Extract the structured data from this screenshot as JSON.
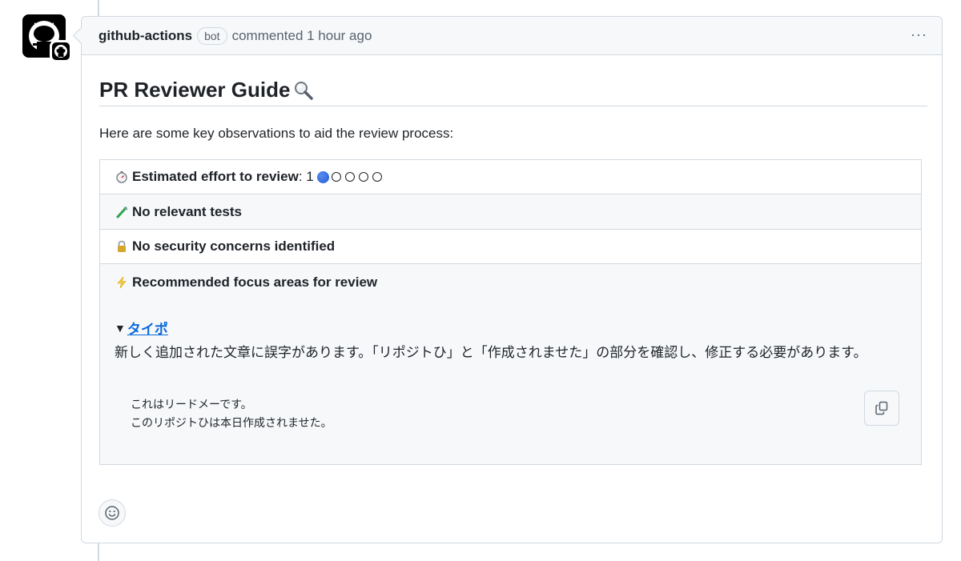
{
  "comment": {
    "author": "github-actions",
    "bot_label": "bot",
    "meta": "commented 1 hour ago",
    "menu_label": "···"
  },
  "body": {
    "title": "PR Reviewer Guide",
    "intro": "Here are some key observations to aid the review process:",
    "rows": [
      {
        "icon": "stopwatch-icon",
        "label": "Estimated effort to review",
        "value": ": 1",
        "effort_score": 1,
        "effort_max": 5
      },
      {
        "icon": "test-tube-icon",
        "label": "No relevant tests"
      },
      {
        "icon": "lock-icon",
        "label": "No security concerns identified"
      },
      {
        "icon": "lightning-icon",
        "label": "Recommended focus areas for review"
      }
    ],
    "focus": {
      "toggle": "▼",
      "link": "タイポ",
      "description": "新しく追加された文章に誤字があります。「リポジトひ」と「作成されませた」の部分を確認し、修正する必要があります。",
      "code_line1": "これはリードメーです。",
      "code_line2": "このリポジトひは本日作成されませた。"
    }
  },
  "colors": {
    "link": "#0969da",
    "border": "#d1d9e0",
    "header_bg": "#f6f8fa"
  }
}
